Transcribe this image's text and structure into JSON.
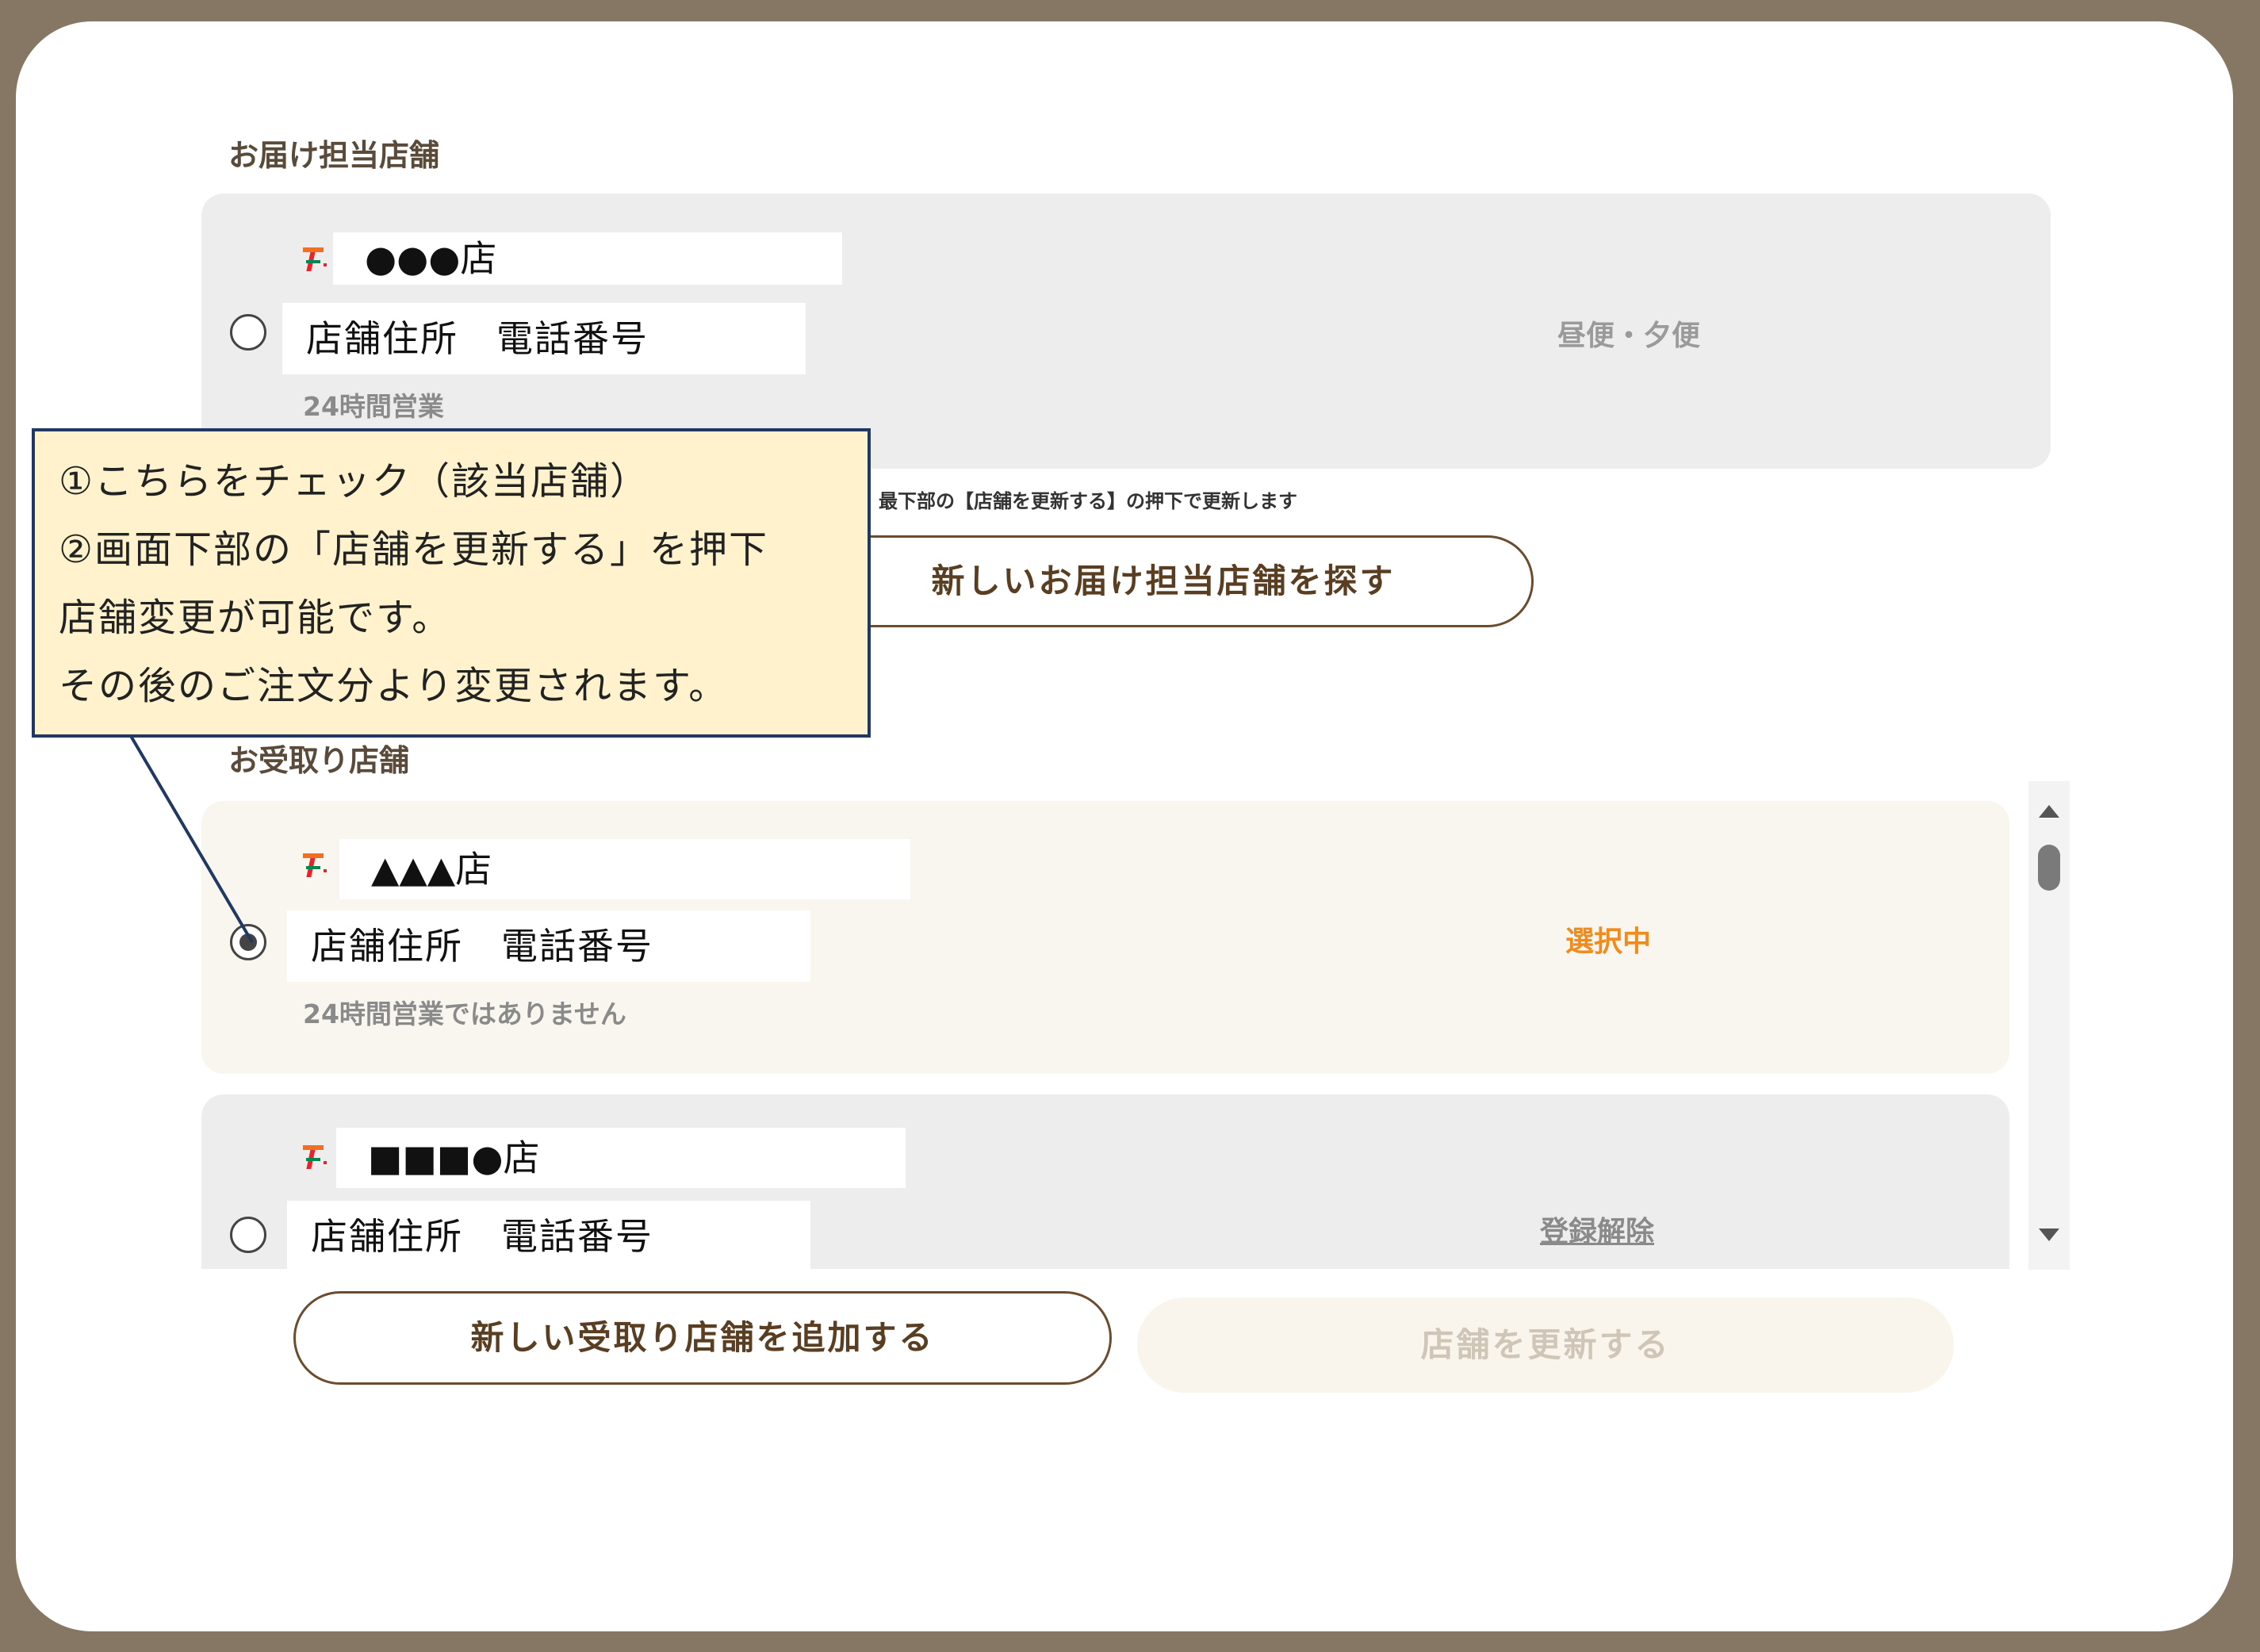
{
  "delivery_section": {
    "title": "お届け担当店舗",
    "store": {
      "name": "●●●店",
      "address": "店舗住所　電話番号",
      "hours": "24時間営業",
      "delivery_slots": "昼便・夕便"
    },
    "note": "最下部の【店舗を更新する】の押下で更新します",
    "find_button": "新しいお届け担当店舗を探す"
  },
  "pickup_section": {
    "title": "お受取り店舗",
    "stores": [
      {
        "name": "▲▲▲店",
        "address": "店舗住所　電話番号",
        "hours": "24時間営業ではありません",
        "status": "選択中",
        "selected": true
      },
      {
        "name": "■■■●店",
        "address": "店舗住所　電話番号",
        "action": "登録解除",
        "selected": false
      }
    ],
    "add_button": "新しい受取り店舗を追加する",
    "update_button": "店舗を更新する"
  },
  "callout": {
    "lines": [
      "①こちらをチェック（該当店舗）",
      "②画面下部の「店舗を更新する」を押下",
      "店舗変更が可能です。",
      "その後のご注文分より変更されます。"
    ]
  },
  "colors": {
    "accent_orange": "#f08c1e",
    "brand_brown": "#5a3e22",
    "frame": "#857763"
  },
  "icons": {
    "store_logo": "seven-eleven-logo-icon",
    "scroll_up": "scroll-up-arrow-icon",
    "scroll_down": "scroll-down-arrow-icon"
  }
}
